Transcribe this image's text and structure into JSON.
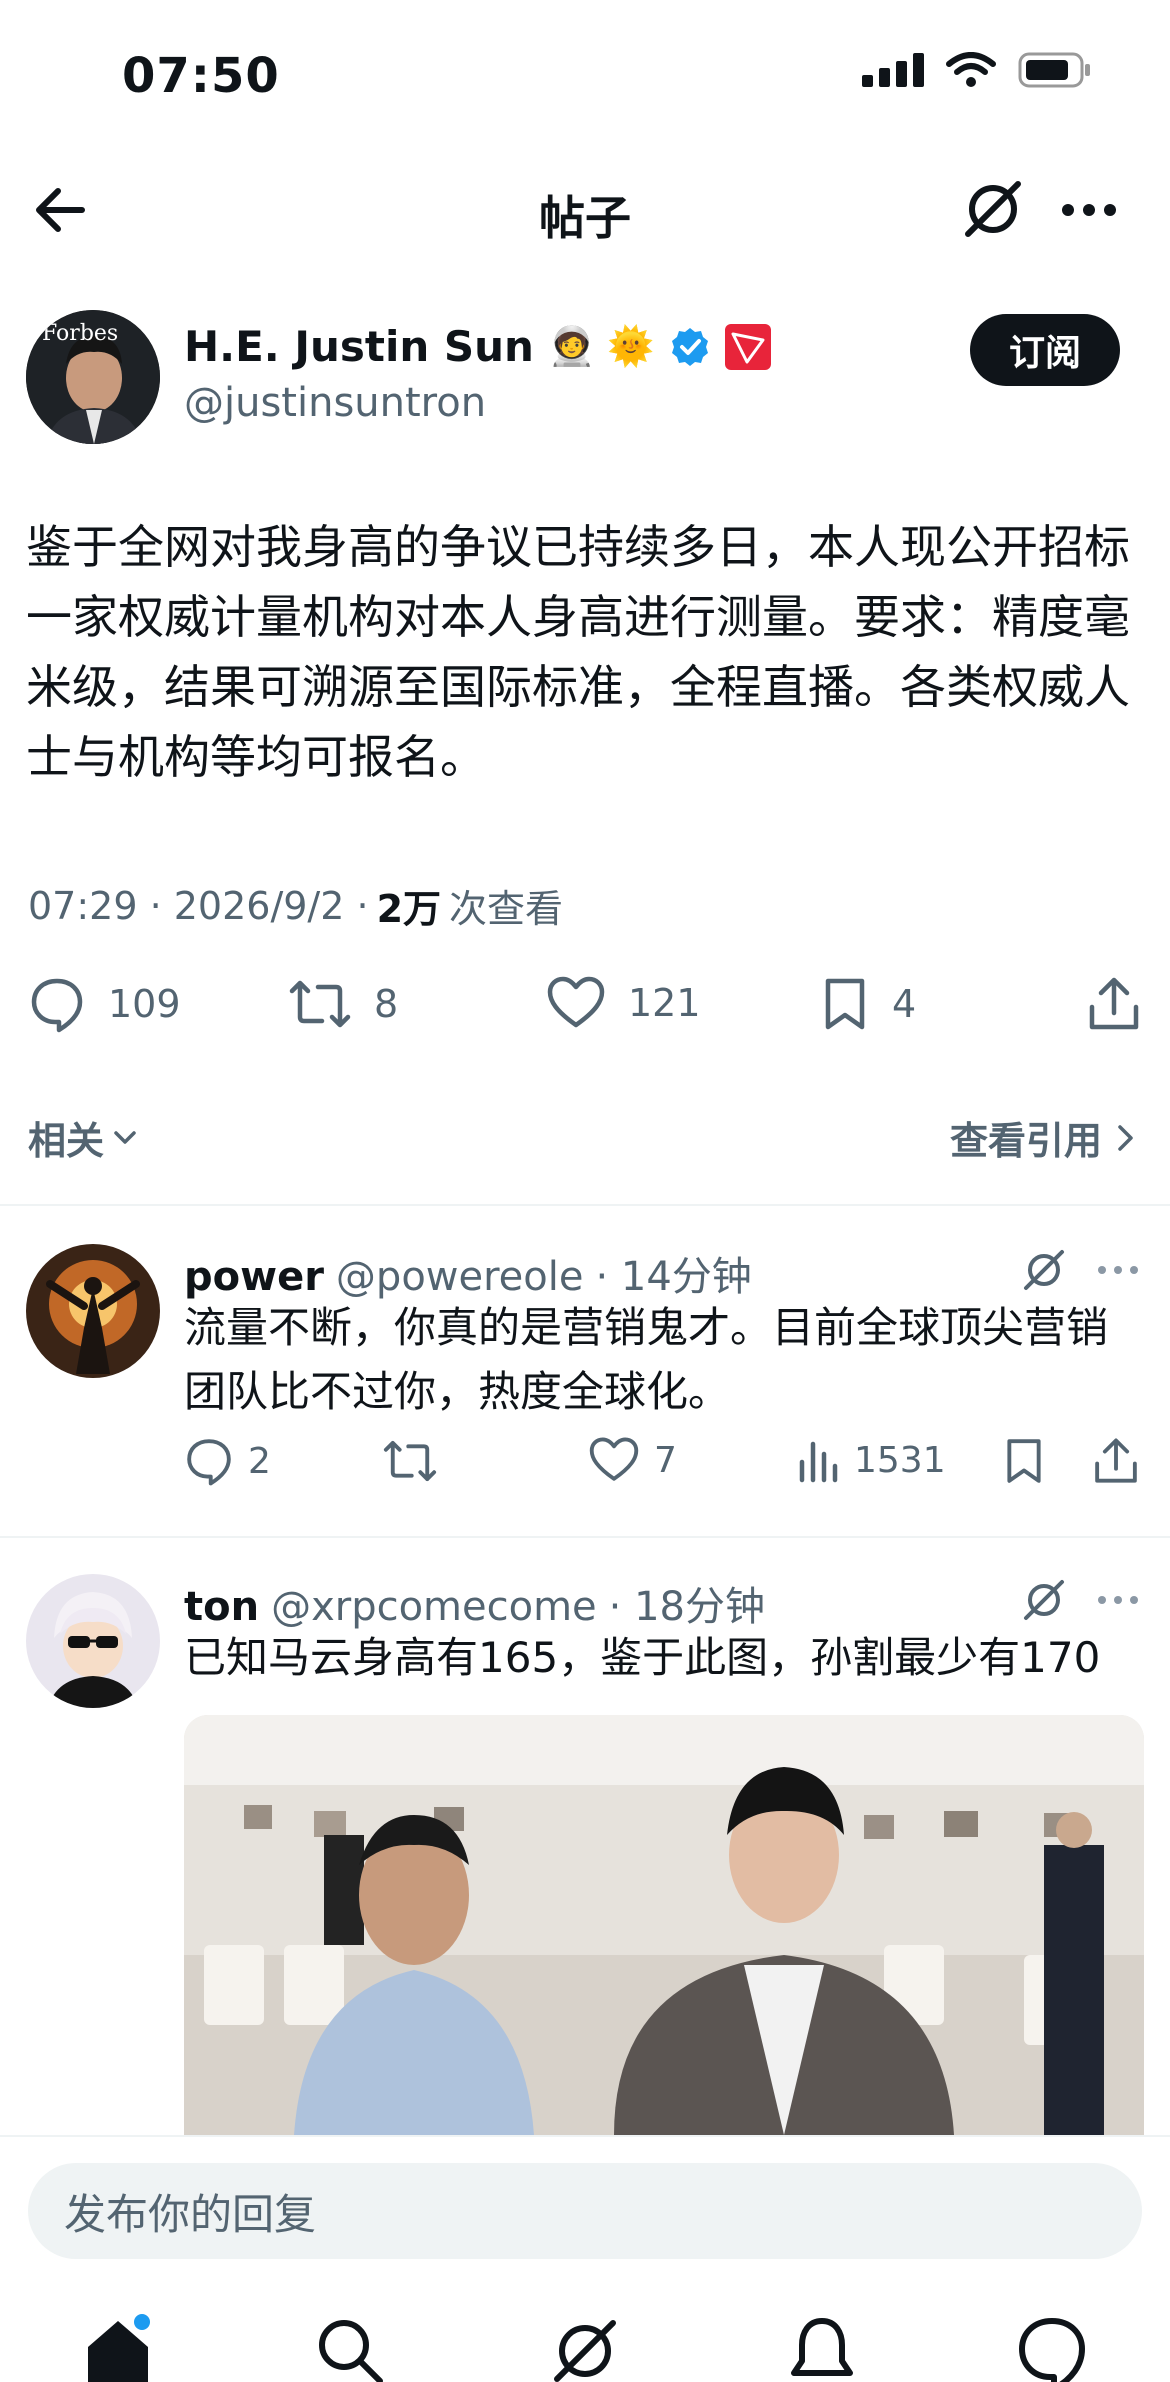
{
  "status_bar": {
    "time": "07:50"
  },
  "nav": {
    "title": "帖子"
  },
  "post": {
    "author_name": "H.E. Justin Sun",
    "author_emojis": "🧑‍🚀 🌞",
    "author_handle": "@justinsuntron",
    "avatar_text": "Forbes",
    "subscribe_label": "订阅",
    "text": "鉴于全网对我身高的争议已持续多日，本人现公开招标一家权威计量机构对本人身高进行测量。要求：精度毫米级，结果可溯源至国际标准，全程直播。各类权威人士与机构等均可报名。",
    "meta_time_date": "07:29 · 2026/9/2 ·",
    "views_count": "2万",
    "views_label": "次查看",
    "replies": "109",
    "reposts": "8",
    "likes": "121",
    "bookmarks": "4"
  },
  "related": {
    "label": "相关",
    "quotes_label": "查看引用"
  },
  "replies": [
    {
      "name": "power",
      "handle": "@powereole",
      "time": "· 14分钟",
      "text": "流量不断，你真的是营销鬼才。目前全球顶尖营销团队比不过你，热度全球化。",
      "reply_count": "2",
      "repost_count": "",
      "like_count": "7",
      "view_count": "1531"
    },
    {
      "name": "ton",
      "handle": "@xrpcomecome",
      "time": "· 18分钟",
      "text": "已知马云身高有165，鉴于此图，孙割最少有170"
    }
  ],
  "compose": {
    "placeholder": "发布你的回复"
  },
  "colors": {
    "accent": "#1d9bf0",
    "text": "#0f1419",
    "muted": "#536471",
    "divider": "#eff3f4"
  }
}
